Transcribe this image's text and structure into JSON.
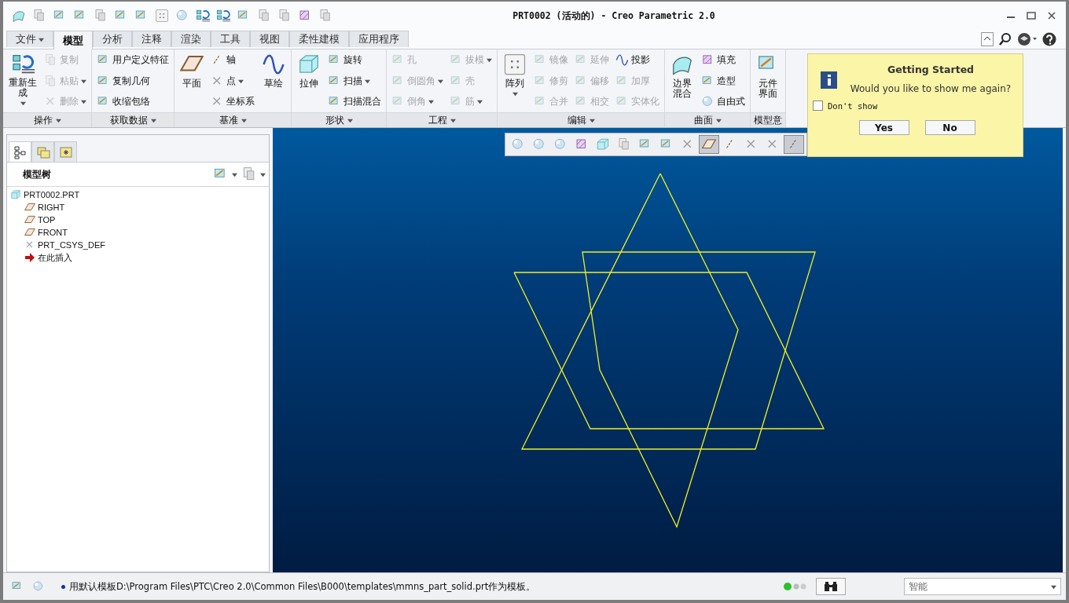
{
  "window": {
    "title": "PRT0002 (活动的) - Creo Parametric 2.0"
  },
  "ribbon_tabs": [
    {
      "label": "文件",
      "kind": "menu",
      "selected": false
    },
    {
      "label": "模型",
      "kind": "tab",
      "selected": true
    },
    {
      "label": "分析",
      "kind": "tab",
      "selected": false
    },
    {
      "label": "注释",
      "kind": "tab",
      "selected": false
    },
    {
      "label": "渲染",
      "kind": "tab",
      "selected": false
    },
    {
      "label": "工具",
      "kind": "tab",
      "selected": false
    },
    {
      "label": "视图",
      "kind": "tab",
      "selected": false
    },
    {
      "label": "柔性建模",
      "kind": "tab",
      "selected": false
    },
    {
      "label": "应用程序",
      "kind": "tab",
      "selected": false
    }
  ],
  "ribbon_groups": [
    {
      "label": "操作",
      "columns": [
        {
          "kind": "large",
          "items": [
            {
              "label_lines": [
                "重新生",
                "成"
              ],
              "dropdown": true,
              "disabled": false
            }
          ]
        },
        {
          "kind": "small",
          "items": [
            {
              "label": "复制",
              "dropdown": false,
              "disabled": true
            },
            {
              "label": "粘贴",
              "dropdown": true,
              "disabled": true
            },
            {
              "label": "删除",
              "dropdown": true,
              "disabled": true
            }
          ]
        }
      ]
    },
    {
      "label": "获取数据",
      "columns": [
        {
          "kind": "small",
          "items": [
            {
              "label": "用户定义特征",
              "dropdown": false,
              "disabled": false
            },
            {
              "label": "复制几何",
              "dropdown": false,
              "disabled": false
            },
            {
              "label": "收缩包络",
              "dropdown": false,
              "disabled": false
            }
          ]
        }
      ]
    },
    {
      "label": "基准",
      "columns": [
        {
          "kind": "large",
          "items": [
            {
              "label": "平面",
              "dropdown": false,
              "disabled": false
            }
          ]
        },
        {
          "kind": "small",
          "items": [
            {
              "label": "轴",
              "dropdown": false,
              "disabled": false
            },
            {
              "label": "点",
              "dropdown": true,
              "disabled": false
            },
            {
              "label": "坐标系",
              "dropdown": false,
              "disabled": false
            }
          ]
        },
        {
          "kind": "large",
          "items": [
            {
              "label": "草绘",
              "dropdown": false,
              "disabled": false
            }
          ]
        }
      ]
    },
    {
      "label": "形状",
      "columns": [
        {
          "kind": "large",
          "items": [
            {
              "label": "拉伸",
              "dropdown": false,
              "disabled": false
            }
          ]
        },
        {
          "kind": "small",
          "items": [
            {
              "label": "旋转",
              "dropdown": false,
              "disabled": false
            },
            {
              "label": "扫描",
              "dropdown": true,
              "disabled": false
            },
            {
              "label": "扫描混合",
              "dropdown": false,
              "disabled": false
            }
          ]
        }
      ]
    },
    {
      "label": "工程",
      "columns": [
        {
          "kind": "small",
          "items": [
            {
              "label": "孔",
              "dropdown": false,
              "disabled": true
            },
            {
              "label": "倒圆角",
              "dropdown": true,
              "disabled": true
            },
            {
              "label": "倒角",
              "dropdown": true,
              "disabled": true
            }
          ]
        },
        {
          "kind": "small",
          "items": [
            {
              "label": "拔模",
              "dropdown": true,
              "disabled": true
            },
            {
              "label": "壳",
              "dropdown": false,
              "disabled": true
            },
            {
              "label": "筋",
              "dropdown": true,
              "disabled": true
            }
          ]
        }
      ]
    },
    {
      "label": "编辑",
      "columns": [
        {
          "kind": "large",
          "items": [
            {
              "label": "阵列",
              "dropdown": true,
              "disabled": false
            }
          ]
        },
        {
          "kind": "small",
          "items": [
            {
              "label": "镜像",
              "dropdown": false,
              "disabled": true
            },
            {
              "label": "修剪",
              "dropdown": false,
              "disabled": true
            },
            {
              "label": "合并",
              "dropdown": false,
              "disabled": true
            }
          ]
        },
        {
          "kind": "small",
          "items": [
            {
              "label": "延伸",
              "dropdown": false,
              "disabled": true
            },
            {
              "label": "偏移",
              "dropdown": false,
              "disabled": true
            },
            {
              "label": "相交",
              "dropdown": false,
              "disabled": true
            }
          ]
        },
        {
          "kind": "small",
          "items": [
            {
              "label": "投影",
              "dropdown": false,
              "disabled": false
            },
            {
              "label": "加厚",
              "dropdown": false,
              "disabled": true
            },
            {
              "label": "实体化",
              "dropdown": false,
              "disabled": true
            }
          ]
        }
      ]
    },
    {
      "label": "曲面",
      "columns": [
        {
          "kind": "large",
          "items": [
            {
              "label_lines": [
                "边界",
                "混合"
              ],
              "dropdown": false,
              "disabled": false
            }
          ]
        },
        {
          "kind": "small",
          "items": [
            {
              "label": "填充",
              "dropdown": false,
              "disabled": false
            },
            {
              "label": "造型",
              "dropdown": false,
              "disabled": false
            },
            {
              "label": "自由式",
              "dropdown": false,
              "disabled": false
            }
          ]
        }
      ]
    },
    {
      "label": "模型意",
      "columns": [
        {
          "kind": "large",
          "items": [
            {
              "label_lines": [
                "元件",
                "界面"
              ],
              "dropdown": false,
              "disabled": false
            }
          ]
        }
      ]
    }
  ],
  "navigator_tabs": [
    {
      "selected": true
    },
    {
      "selected": false
    },
    {
      "selected": false
    }
  ],
  "model_tree": {
    "title": "模型树",
    "items": [
      {
        "label": "PRT0002.PRT",
        "kind": "part",
        "children": [
          {
            "label": "RIGHT",
            "kind": "plane"
          },
          {
            "label": "TOP",
            "kind": "plane"
          },
          {
            "label": "FRONT",
            "kind": "plane"
          },
          {
            "label": "PRT_CSYS_DEF",
            "kind": "csys"
          },
          {
            "label": "在此插入",
            "kind": "insert"
          }
        ]
      }
    ]
  },
  "view_toolbar": [
    {
      "on": false
    },
    {
      "on": false
    },
    {
      "on": false
    },
    {
      "on": false
    },
    {
      "on": false
    },
    {
      "on": false
    },
    {
      "on": false
    },
    {
      "on": false
    },
    {
      "on": false
    },
    {
      "on": true
    },
    {
      "on": false
    },
    {
      "on": false
    },
    {
      "on": false
    },
    {
      "on": true
    }
  ],
  "popup": {
    "title": "Getting Started",
    "message": "Would you like to show me again?",
    "checkbox": {
      "label": "Don't show",
      "checked": false
    },
    "buttons": [
      "Yes",
      "No"
    ]
  },
  "status_bar": {
    "message": "用默认模板D:\\Program Files\\PTC\\Creo 2.0\\Common Files\\B000\\templates\\mmns_part_solid.prt作为模板。",
    "filter": "智能"
  }
}
